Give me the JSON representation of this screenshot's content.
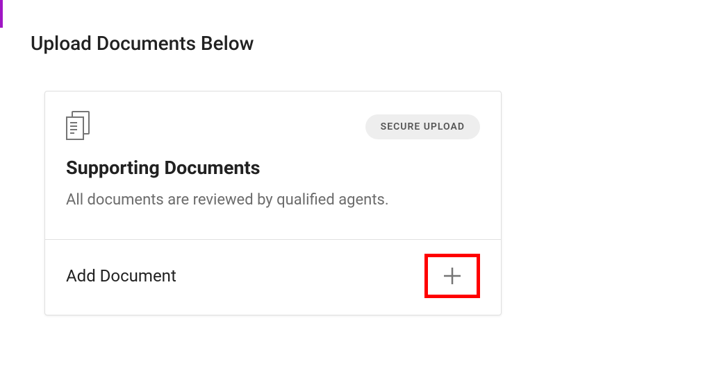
{
  "page": {
    "title": "Upload Documents Below"
  },
  "card": {
    "badge": "SECURE UPLOAD",
    "title": "Supporting Documents",
    "subtitle": "All documents are reviewed by qualified agents.",
    "action_label": "Add Document"
  },
  "icons": {
    "document": "document-stack-icon",
    "plus": "plus-icon"
  },
  "colors": {
    "accent": "#a016c4",
    "highlight_border": "#ff0000"
  }
}
